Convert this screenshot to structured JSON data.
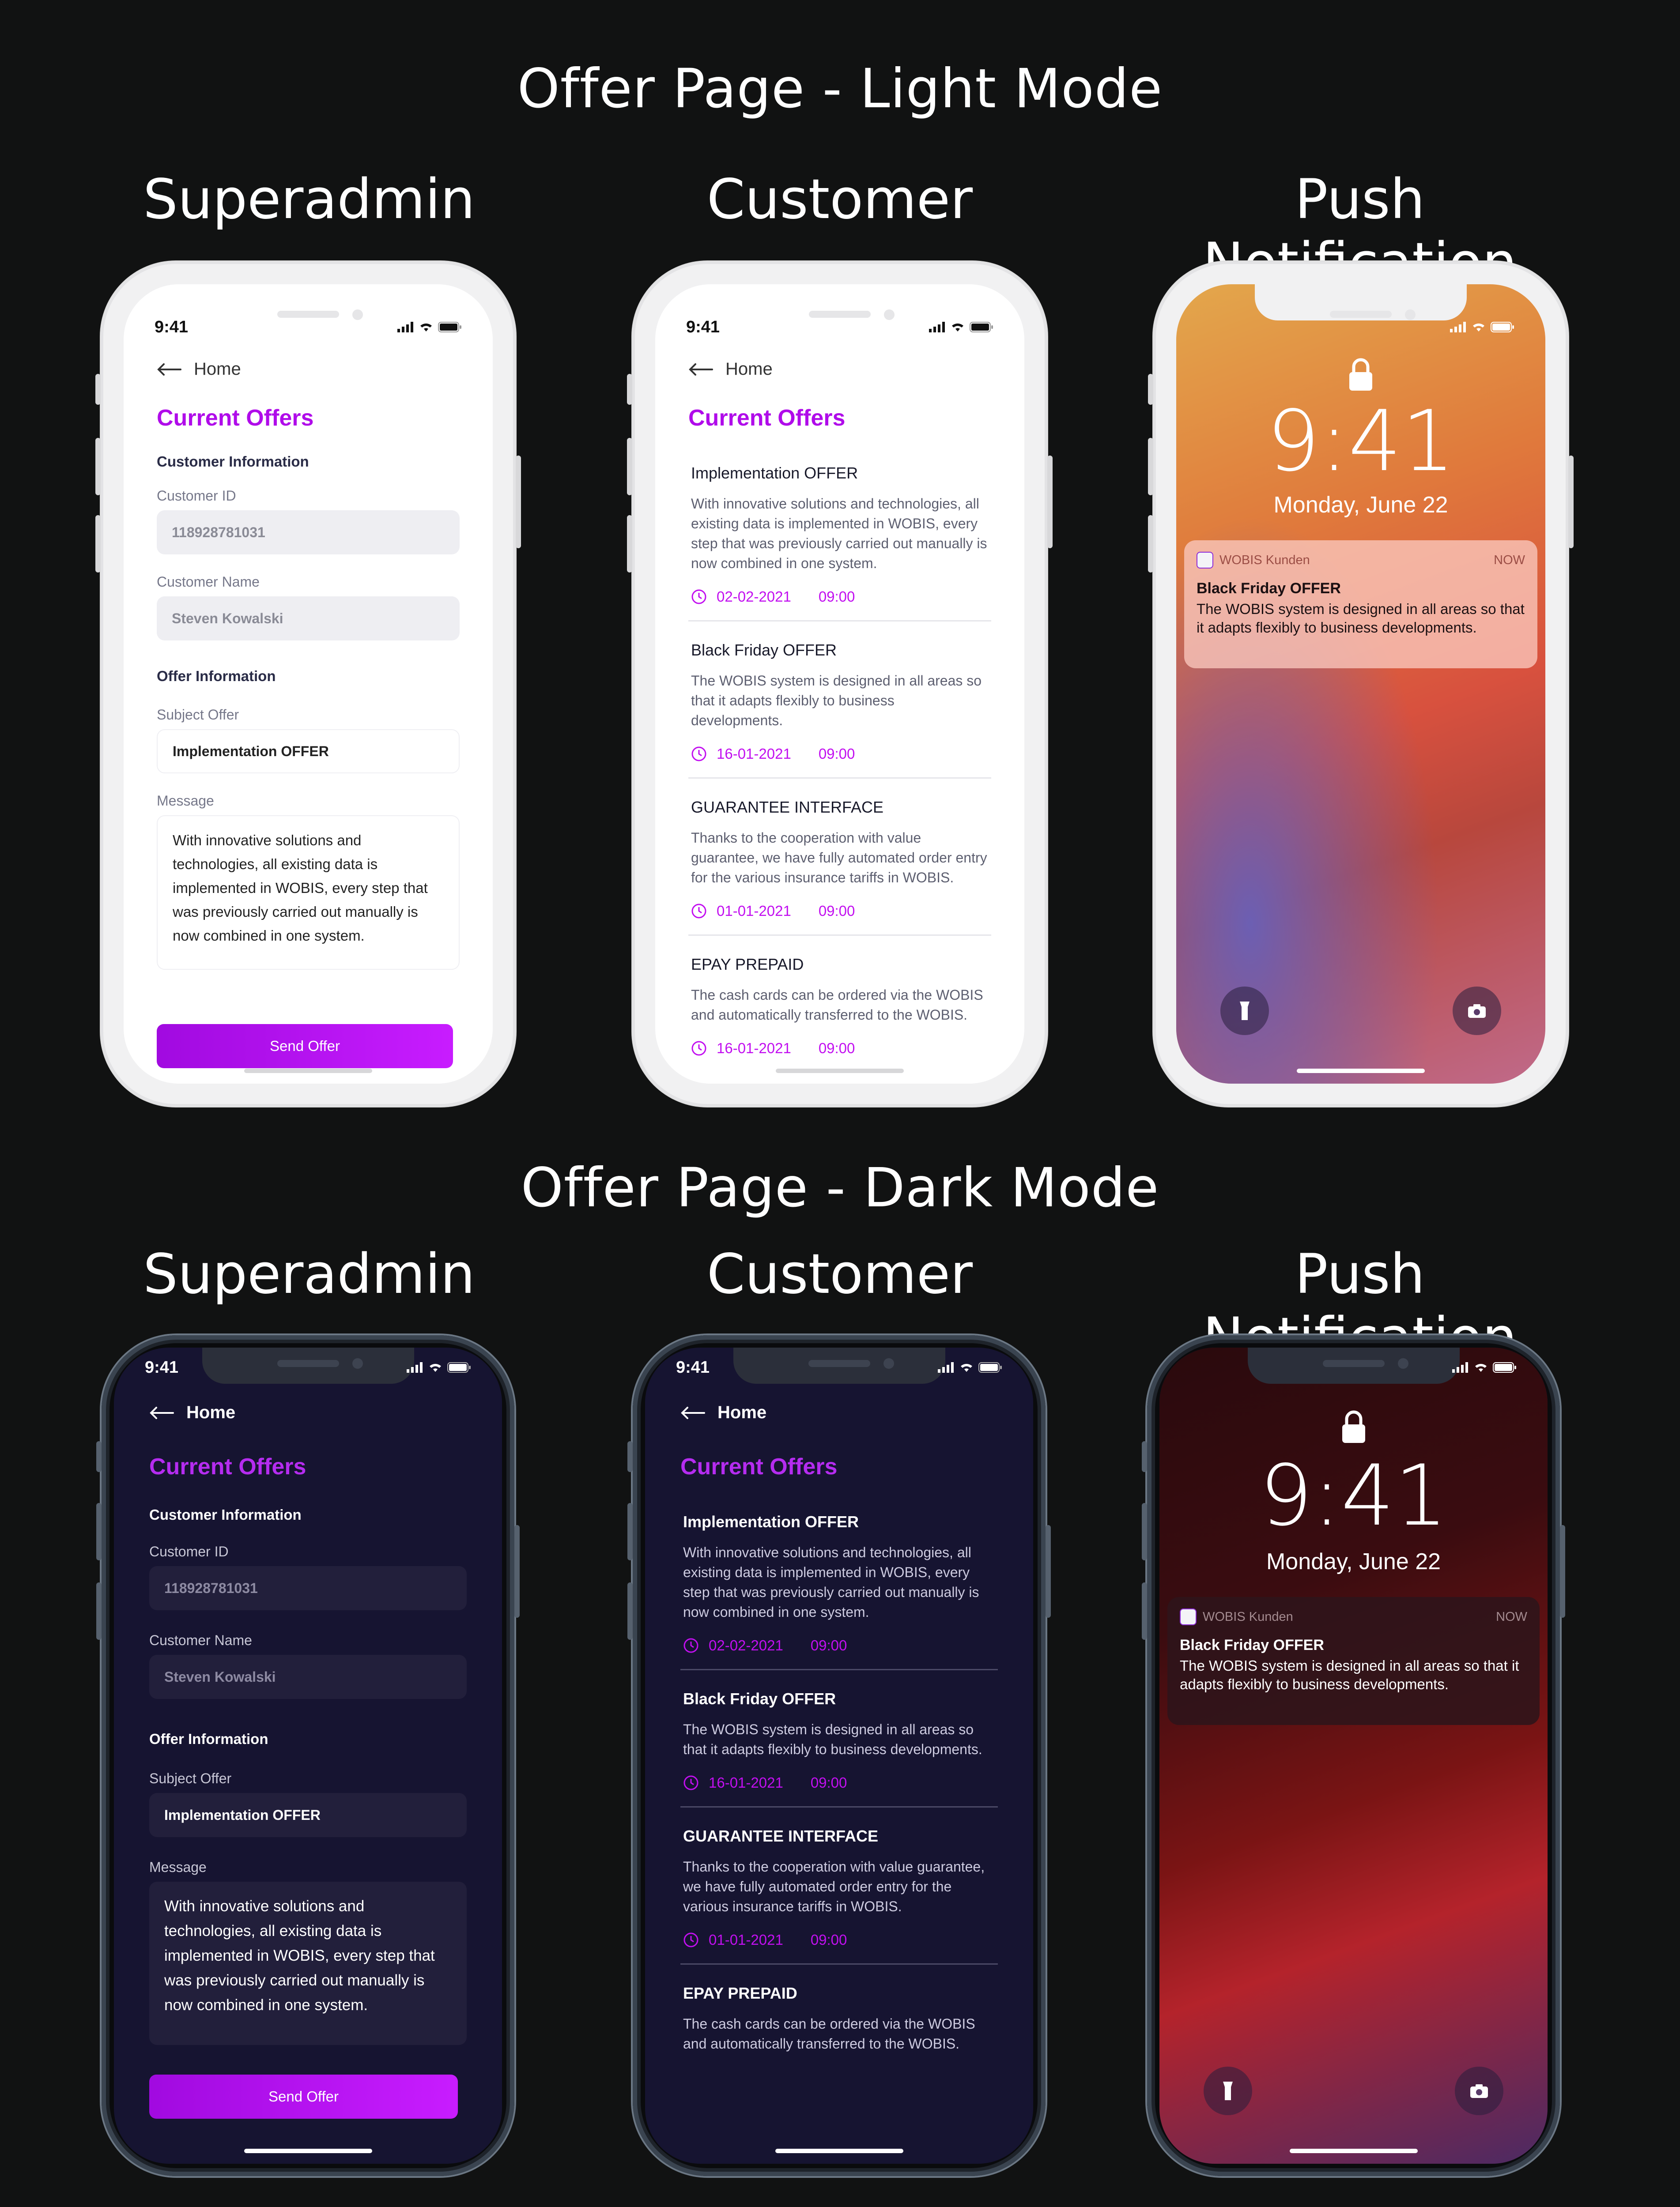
{
  "sections": {
    "light_title": "Offer Page - Light Mode",
    "dark_title": "Offer Page - Dark Mode"
  },
  "columns": {
    "superadmin": "Superadmin",
    "customer": "Customer",
    "push": "Push Notification"
  },
  "status_time": "9:41",
  "nav": {
    "back_label": "Home"
  },
  "page_title": "Current Offers",
  "superadmin_form": {
    "customer_info_heading": "Customer Information",
    "customer_id_label": "Customer ID",
    "customer_id_value": "118928781031",
    "customer_name_label": "Customer Name",
    "customer_name_value": "Steven Kowalski",
    "offer_info_heading": "Offer Information",
    "subject_label": "Subject Offer",
    "subject_value": "Implementation OFFER",
    "message_label": "Message",
    "message_value": "With innovative solutions and technologies, all existing data is implemented in WOBIS, every step that was previously carried out manually is now combined in one system.",
    "send_button": "Send Offer"
  },
  "offers": [
    {
      "title": "Implementation OFFER",
      "description": "With innovative solutions and technologies, all existing data is implemented in WOBIS, every step that was previously carried out manually is now combined in one system.",
      "date": "02-02-2021",
      "time": "09:00"
    },
    {
      "title": "Black Friday OFFER",
      "description": "The WOBIS system is designed in all areas so that it adapts flexibly to business developments.",
      "date": "16-01-2021",
      "time": "09:00"
    },
    {
      "title": "GUARANTEE INTERFACE",
      "description": "Thanks to the cooperation with value guarantee, we have fully automated order entry for the various insurance tariffs in WOBIS.",
      "date": "01-01-2021",
      "time": "09:00"
    },
    {
      "title": "EPAY PREPAID",
      "description": "The cash cards can be ordered via the WOBIS and automatically transferred to the WOBIS.",
      "date": "16-01-2021",
      "time": "09:00"
    }
  ],
  "lock_screen": {
    "time": "9:41",
    "date": "Monday, June 22",
    "notification": {
      "app": "WOBIS Kunden",
      "when": "NOW",
      "title": "Black Friday OFFER",
      "body": "The WOBIS system is designed in all areas so that it adapts flexibly to business developments."
    }
  },
  "colors": {
    "accent": "#b00bea",
    "background": "#111212",
    "dark_screen": "#161431"
  },
  "icons": [
    "back-arrow-icon",
    "clock-icon",
    "lock-icon",
    "flashlight-icon",
    "camera-icon",
    "signal-icon",
    "wifi-icon",
    "battery-icon"
  ]
}
